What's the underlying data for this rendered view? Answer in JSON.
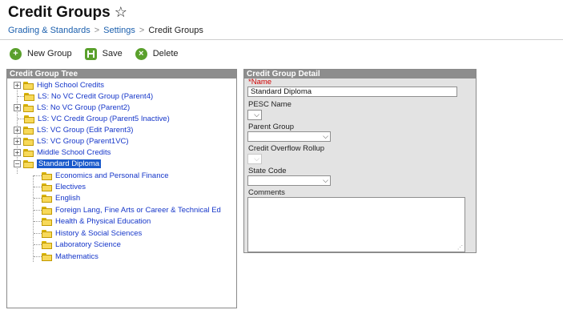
{
  "page": {
    "title": "Credit Groups",
    "star_icon": "☆"
  },
  "breadcrumb": [
    "Grading & Standards",
    "Settings",
    "Credit Groups"
  ],
  "breadcrumb_separator": ">",
  "toolbar": {
    "new_label": "New Group",
    "save_label": "Save",
    "delete_label": "Delete",
    "colors": {
      "new": "#5aa02c",
      "save": "#5aa02c",
      "delete": "#5aa02c"
    }
  },
  "tree": {
    "header": "Credit Group Tree",
    "items": [
      "High School Credits",
      "LS: No VC Credit Group (Parent4)",
      "LS: No VC Group (Parent2)",
      "LS: VC Credit Group (Parent5 Inactive)",
      "LS: VC Group (Edit Parent3)",
      "LS: VC Group (Parent1VC)",
      "Middle School Credits",
      "Standard Diploma"
    ],
    "children": [
      "Economics and Personal Finance",
      "Electives",
      "English",
      "Foreign Lang, Fine Arts or Career & Technical Ed",
      "Health & Physical Education",
      "History & Social Sciences",
      "Laboratory Science",
      "Mathematics"
    ],
    "expand_symbols": {
      "collapsed": "+",
      "expanded": "−"
    }
  },
  "detail": {
    "header": "Credit Group Detail",
    "required_marker": "*",
    "name_label": "Name",
    "name_value": "Standard Diploma",
    "pesc_label": "PESC Name",
    "parent_label": "Parent Group",
    "overflow_label": "Credit Overflow Rollup",
    "state_label": "State Code",
    "comments_label": "Comments",
    "dropdown_arrow": "⌵",
    "resize_grip": "⋰"
  }
}
